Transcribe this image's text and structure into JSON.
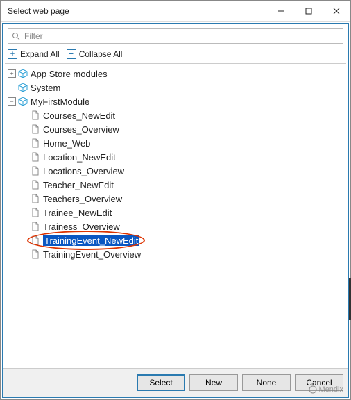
{
  "window": {
    "title": "Select web page"
  },
  "filter": {
    "placeholder": "Filter"
  },
  "toolbar": {
    "expand_all": "Expand All",
    "collapse_all": "Collapse All"
  },
  "tree": {
    "root_app_store": "App Store modules",
    "root_system": "System",
    "root_module": "MyFirstModule",
    "pages": [
      "Courses_NewEdit",
      "Courses_Overview",
      "Home_Web",
      "Location_NewEdit",
      "Locations_Overview",
      "Teacher_NewEdit",
      "Teachers_Overview",
      "Trainee_NewEdit",
      "Trainess_Overview",
      "TrainingEvent_NewEdit",
      "TrainingEvent_Overview"
    ],
    "selected_index": 9
  },
  "buttons": {
    "select": "Select",
    "new": "New",
    "none": "None",
    "cancel": "Cancel"
  },
  "watermark": "Mendix"
}
